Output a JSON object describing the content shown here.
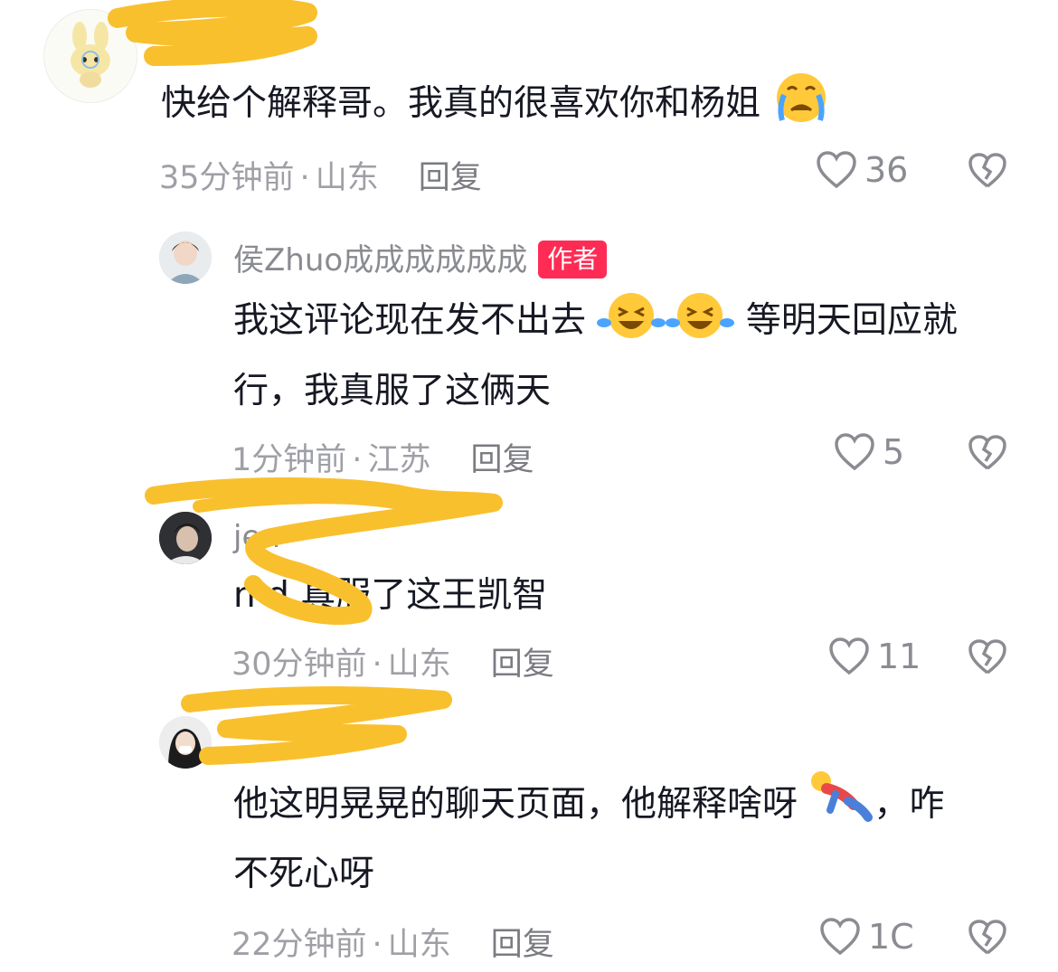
{
  "comments": [
    {
      "username": "",
      "text": "快给个解释哥。我真的很喜欢你和杨姐",
      "time": "35分钟前",
      "location": "山东",
      "reply_label": "回复",
      "likes": "36",
      "avatar": "bunny-avatar",
      "emoji": "crying-face"
    },
    {
      "username": "侯Zhuo成成成成成成",
      "author_badge": "作者",
      "text_line1": "我这评论现在发不出去",
      "text_line1_after": "等明天回应就",
      "text_line2": "行，我真服了这俩天",
      "time": "1分钟前",
      "location": "江苏",
      "reply_label": "回复",
      "likes": "5",
      "emoji": "laughing-crying-face"
    },
    {
      "username": "jen",
      "text": "n d 真服了这王凯智",
      "time": "30分钟前",
      "location": "山东",
      "reply_label": "回复",
      "likes": "11"
    },
    {
      "username": "",
      "text_line1": "他这明晃晃的聊天页面，他解释啥呀",
      "text_line1_after": "，咋",
      "text_line2": "不死心呀",
      "time": "22分钟前",
      "location": "山东",
      "reply_label": "回复",
      "likes": "1C",
      "emoji": "falling-person"
    }
  ],
  "colors": {
    "badge": "#fe2c55",
    "scribble": "#f9c02e",
    "meta": "#9fa0a6"
  }
}
